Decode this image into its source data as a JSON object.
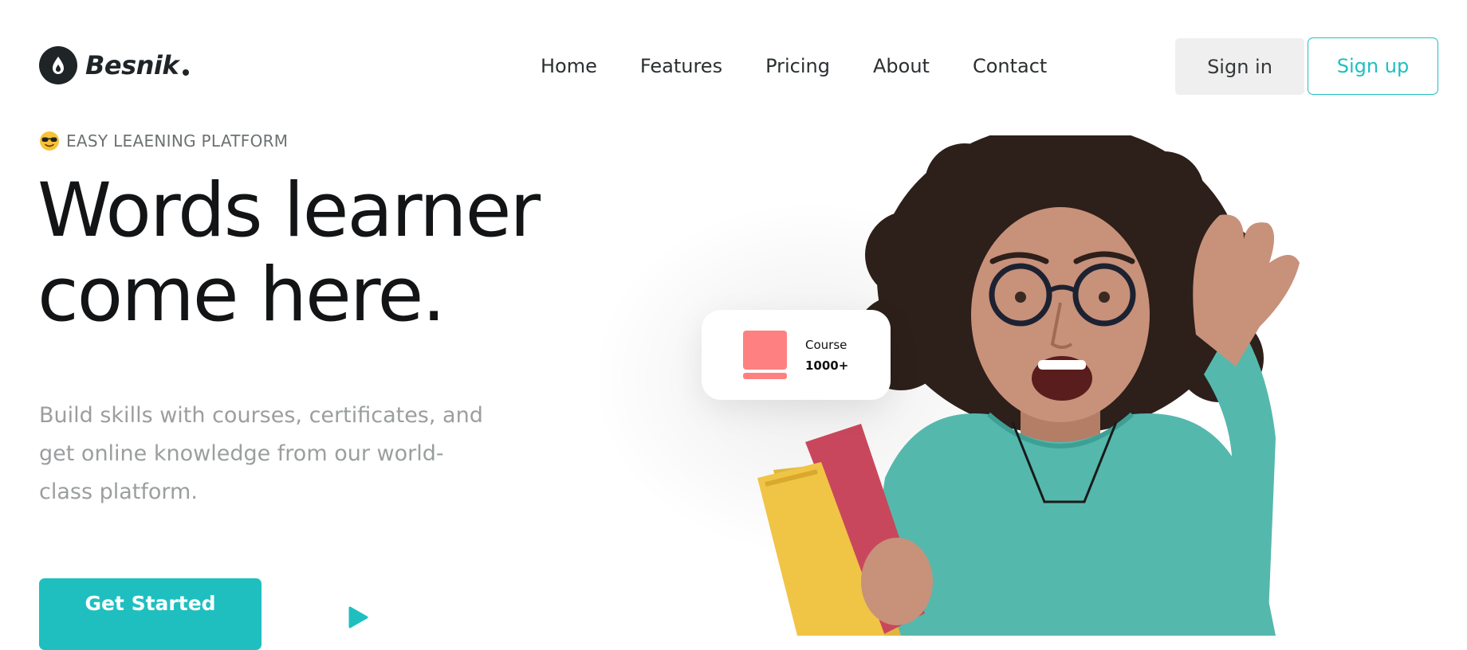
{
  "brand": {
    "name": "Besnik",
    "logo_icon": "droplet-icon"
  },
  "nav": {
    "items": [
      "Home",
      "Features",
      "Pricing",
      "About",
      "Contact"
    ]
  },
  "auth": {
    "signin_label": "Sign in",
    "signup_label": "Sign up"
  },
  "hero": {
    "eyebrow_emoji": "sunglasses-face-icon",
    "eyebrow": "EASY LEAENING PLATFORM",
    "headline_line1": "Words learner",
    "headline_line2": "come here.",
    "subtext": "Build skills with courses, certificates, and get online knowledge from our world-class platform.",
    "cta_label": "Get Started",
    "play_icon": "play-icon"
  },
  "course_card": {
    "icon": "book-icon",
    "label": "Course",
    "count": "1000+"
  },
  "colors": {
    "accent": "#1fbfc0",
    "dark": "#1f2427",
    "muted": "#9b9e9f",
    "card_icon": "#ff8080",
    "shirt": "#55b8ad"
  }
}
